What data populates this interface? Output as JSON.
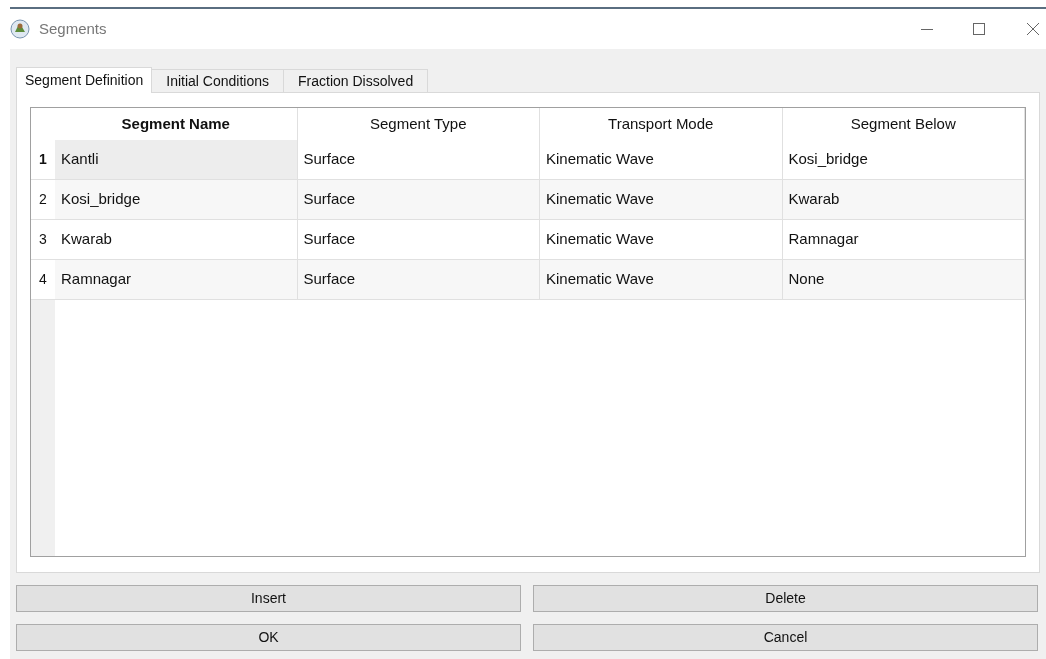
{
  "window": {
    "title": "Segments"
  },
  "tabs": [
    {
      "label": "Segment Definition",
      "selected": true
    },
    {
      "label": "Initial Conditions",
      "selected": false
    },
    {
      "label": "Fraction Dissolved",
      "selected": false
    }
  ],
  "table": {
    "columns": [
      {
        "label": "Segment Name",
        "selected": true
      },
      {
        "label": "Segment Type",
        "selected": false
      },
      {
        "label": "Transport Mode",
        "selected": false
      },
      {
        "label": "Segment Below",
        "selected": false
      }
    ],
    "rows": [
      {
        "number": "1",
        "selected": true,
        "cells": [
          "Kantli",
          "Surface",
          "Kinematic Wave",
          "Kosi_bridge"
        ]
      },
      {
        "number": "2",
        "selected": false,
        "cells": [
          "Kosi_bridge",
          "Surface",
          "Kinematic Wave",
          "Kwarab"
        ]
      },
      {
        "number": "3",
        "selected": false,
        "cells": [
          "Kwarab",
          "Surface",
          "Kinematic Wave",
          "Ramnagar"
        ]
      },
      {
        "number": "4",
        "selected": false,
        "cells": [
          "Ramnagar",
          "Surface",
          "Kinematic Wave",
          "None"
        ]
      }
    ]
  },
  "buttons": [
    "Insert",
    "Delete",
    "OK",
    "Cancel"
  ]
}
